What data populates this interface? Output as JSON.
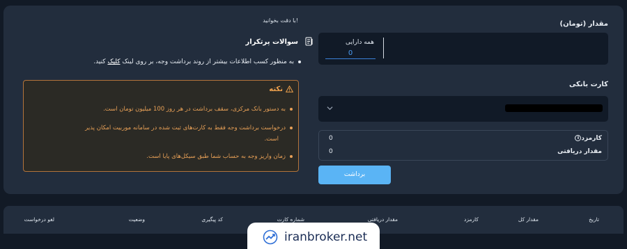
{
  "form": {
    "amount_label": "مقدار (تومان)",
    "all_assets_label": "همه دارایی",
    "all_assets_value": "0",
    "bank_card_label": "کارت بانکی",
    "fee_label": "کارمزد",
    "fee_value": "0",
    "received_label": "مقدار دریافتی",
    "received_value": "0",
    "withdraw_button": "برداشت"
  },
  "guide": {
    "read_carefully": "با دقت بخوانید!",
    "faq_title": "سوالات پرتکرار",
    "faq_bullet_text": "به منظور کسب اطلاعات بیشتر از روند برداشت وجه، بر روی لینک",
    "faq_bullet_link": "کلیک",
    "faq_bullet_end": "کنید."
  },
  "note": {
    "title": "نکته",
    "items": [
      "به دستور بانک مرکزی، سقف برداشت در هر روز 100 میلیون تومان است.",
      "درخواست برداشت وجه فقط به کارت‌های ثبت شده در سامانه موربیت امکان پذیر",
      "است.",
      "زمان واریز وجه به حساب شما طبق سیکل‌های پایا است."
    ]
  },
  "table": {
    "headers": [
      "تاریخ",
      "مقدار کل",
      "کارمزد",
      "مقدار دریافتی",
      "شماره کارت",
      "کد پیگیری",
      "وضعیت",
      "لغو درخواست"
    ]
  },
  "watermark": {
    "text": "iranbroker.net"
  },
  "colors": {
    "background": "#121a26",
    "card": "#222d3d",
    "input": "#111a27",
    "accent_blue": "#5ab4f5",
    "note_orange": "#e9a157"
  },
  "icons": [
    "chevron-down-icon",
    "info-icon",
    "document-icon",
    "warning-icon",
    "trend-up-icon"
  ]
}
